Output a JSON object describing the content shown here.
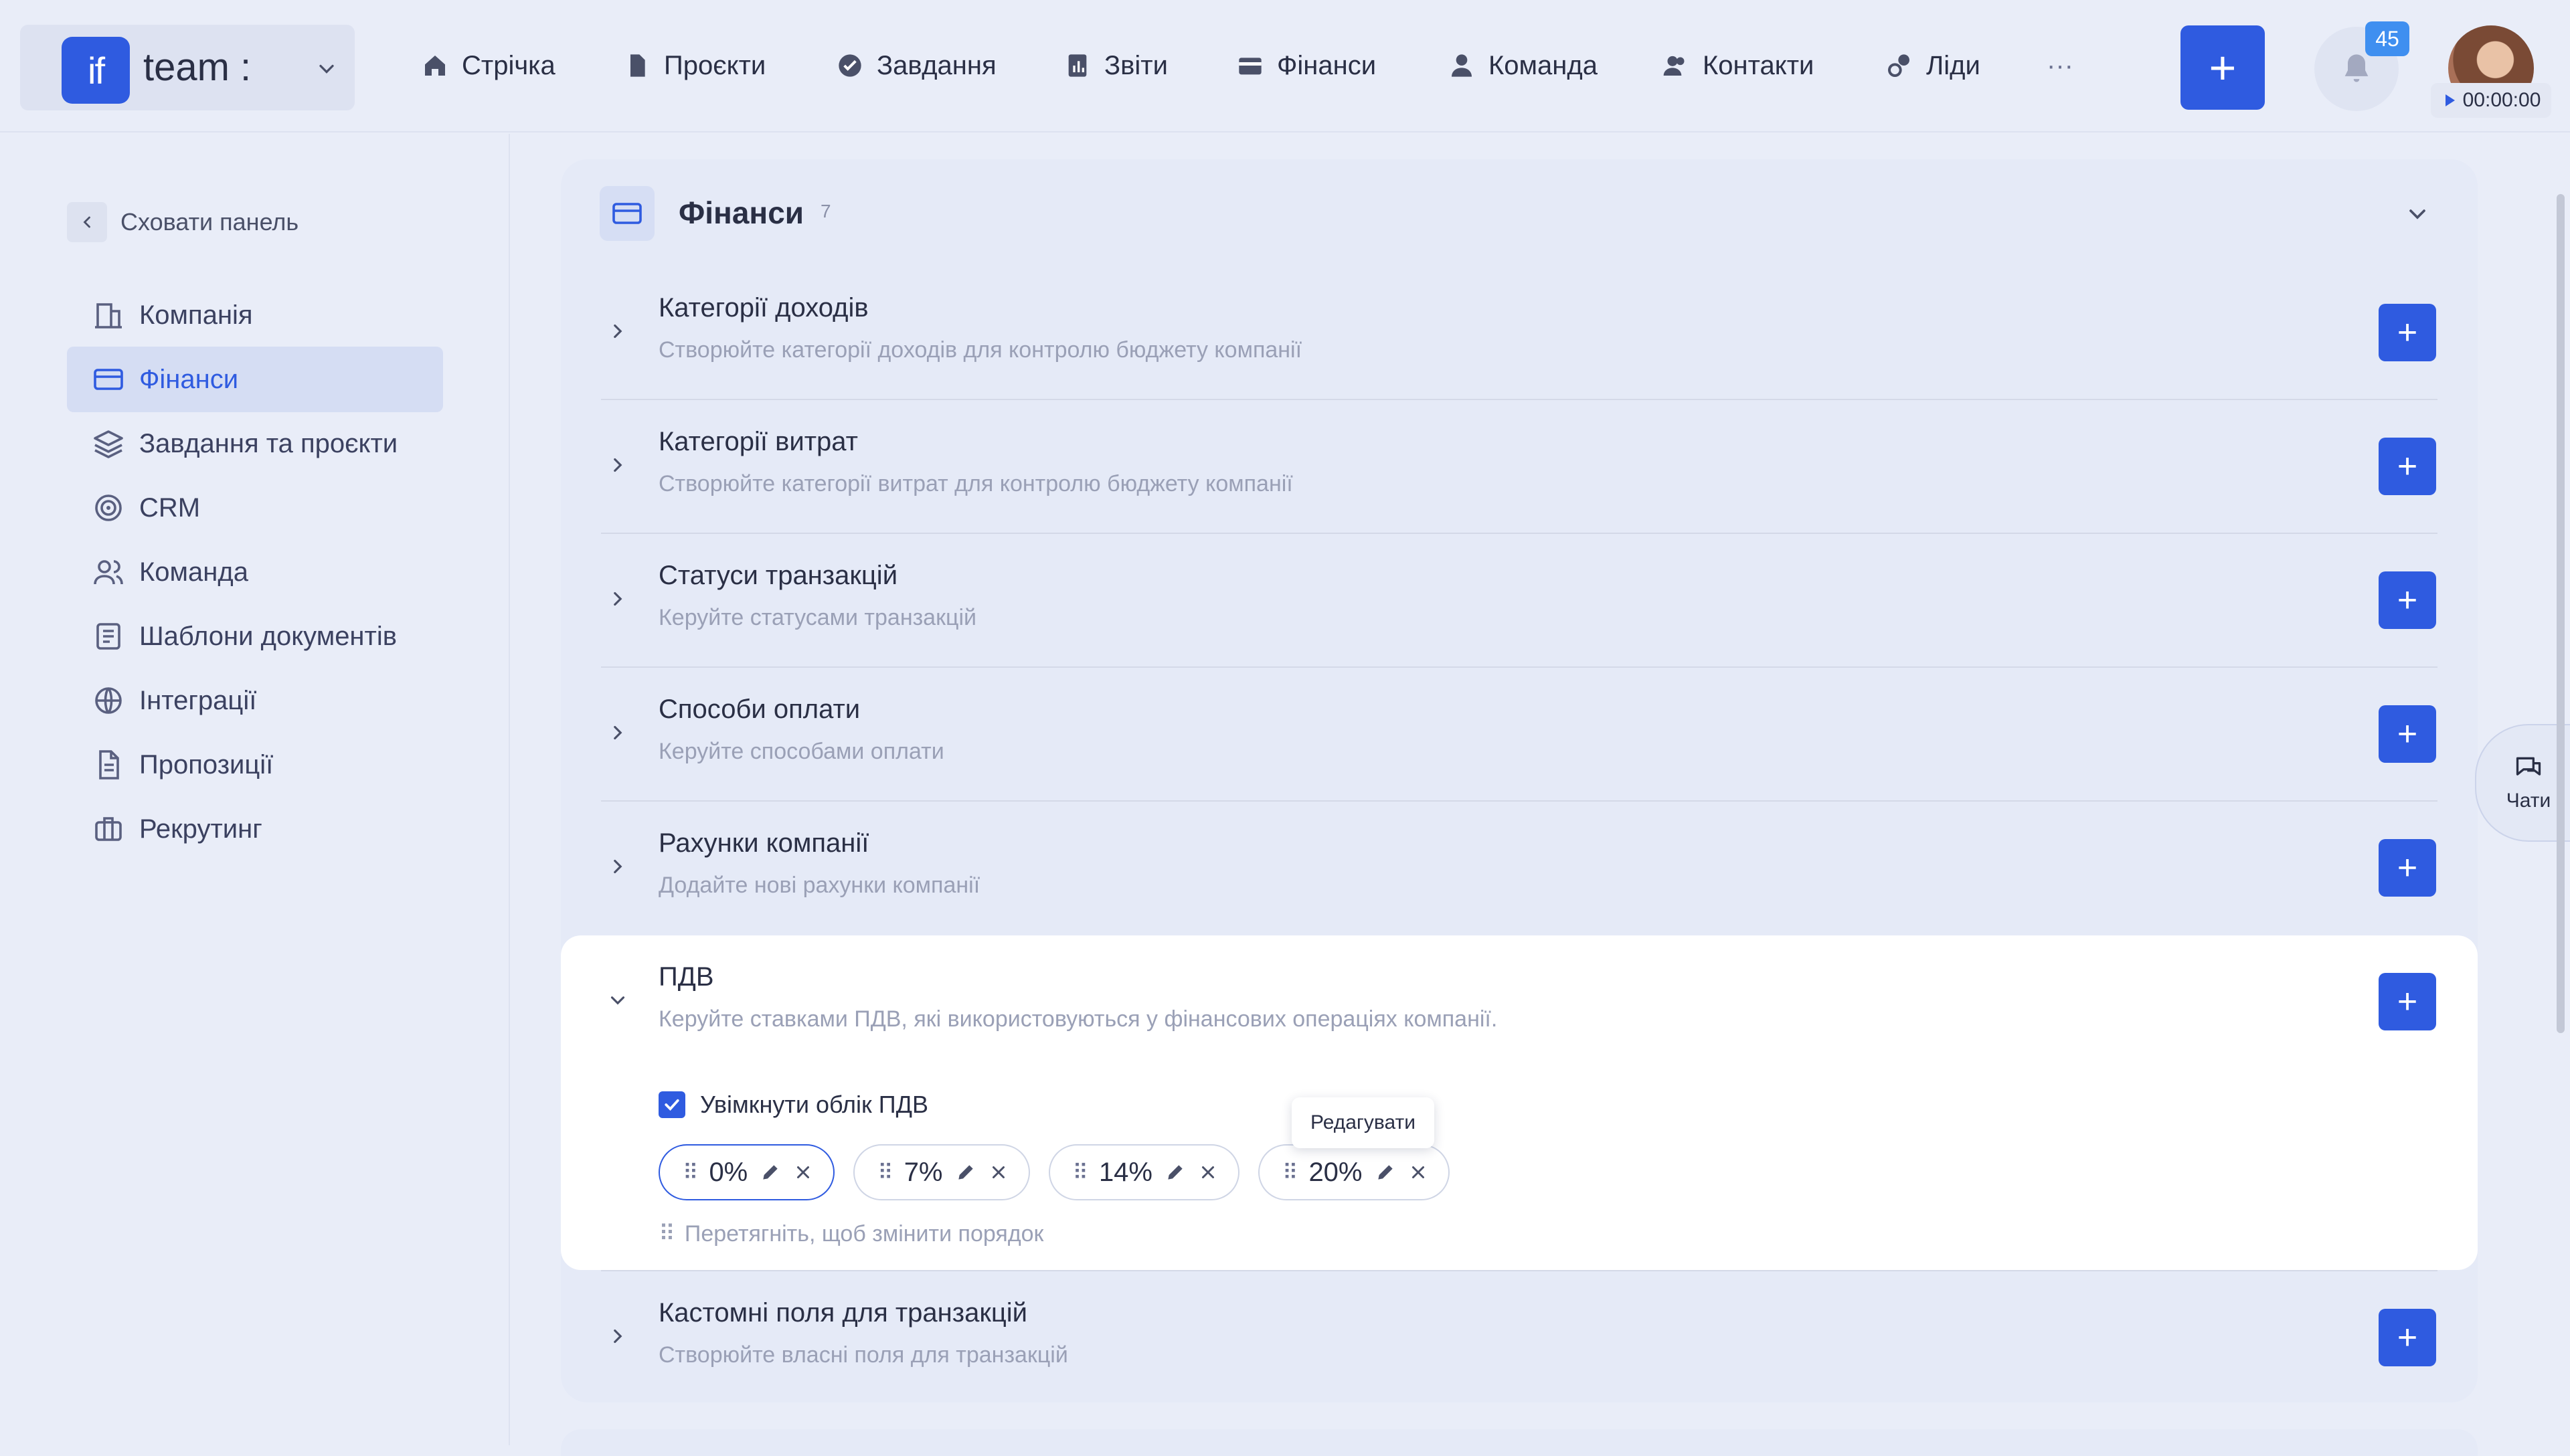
{
  "brand": {
    "logo": "if",
    "name": "team :"
  },
  "nav": [
    {
      "icon": "home-icon",
      "label": "Стрічка"
    },
    {
      "icon": "file-icon",
      "label": "Проєкти"
    },
    {
      "icon": "check-circle-icon",
      "label": "Завдання"
    },
    {
      "icon": "report-icon",
      "label": "Звіти"
    },
    {
      "icon": "wallet-icon",
      "label": "Фінанси"
    },
    {
      "icon": "user-icon",
      "label": "Команда"
    },
    {
      "icon": "contacts-icon",
      "label": "Контакти"
    },
    {
      "icon": "leads-icon",
      "label": "Ліди"
    }
  ],
  "nav_more": "···",
  "header_actions": {
    "add": "+",
    "notifications_count": "45",
    "timer": "00:00:00"
  },
  "sidebar": {
    "hide_label": "Сховати панель",
    "items": [
      {
        "icon": "company-icon",
        "label": "Компанія"
      },
      {
        "icon": "card-icon",
        "label": "Фінанси"
      },
      {
        "icon": "layers-icon",
        "label": "Завдання та проєкти"
      },
      {
        "icon": "target-icon",
        "label": "CRM"
      },
      {
        "icon": "users-icon",
        "label": "Команда"
      },
      {
        "icon": "document-icon",
        "label": "Шаблони документів"
      },
      {
        "icon": "globe-icon",
        "label": "Інтеграції"
      },
      {
        "icon": "proposal-icon",
        "label": "Пропозиції"
      },
      {
        "icon": "briefcase-icon",
        "label": "Рекрутинг"
      }
    ],
    "active_index": 1
  },
  "section": {
    "title": "Фінанси",
    "count": "7",
    "rows": [
      {
        "title": "Категорії доходів",
        "desc": "Створюйте категорії доходів для контролю бюджету компанії"
      },
      {
        "title": "Категорії витрат",
        "desc": "Створюйте категорії витрат для контролю бюджету компанії"
      },
      {
        "title": "Статуси транзакцій",
        "desc": "Керуйте статусами транзакцій"
      },
      {
        "title": "Способи оплати",
        "desc": "Керуйте способами оплати"
      },
      {
        "title": "Рахунки компанії",
        "desc": "Додайте нові рахунки компанії"
      }
    ],
    "vat": {
      "title": "ПДВ",
      "desc": "Керуйте ставками ПДВ, які використовуються у фінансових операціях компанії.",
      "enable_label": "Увімкнути облік ПДВ",
      "enabled": true,
      "rates": [
        "0%",
        "7%",
        "14%",
        "20%"
      ],
      "selected_rate": "0%",
      "drag_hint": "Перетягніть, щоб змінити порядок",
      "tooltip": "Редагувати"
    },
    "last_row": {
      "title": "Кастомні поля для транзакцій",
      "desc": "Створюйте власні поля для транзакцій"
    }
  },
  "chat": {
    "label": "Чати"
  },
  "colors": {
    "accent": "#2f5be0",
    "background": "#e9edf8",
    "badge": "#3f8ff0"
  }
}
